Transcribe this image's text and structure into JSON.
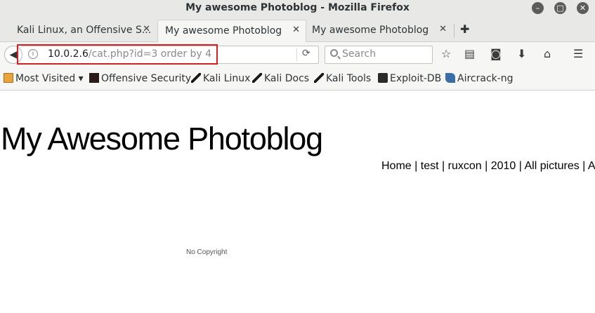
{
  "window": {
    "title": "My awesome Photoblog - Mozilla Firefox"
  },
  "tabs": [
    {
      "label": "Kali Linux, an Offensive S..."
    },
    {
      "label": "My awesome Photoblog"
    },
    {
      "label": "My awesome Photoblog"
    }
  ],
  "urlbar": {
    "host": "10.0.2.6",
    "path": "/cat.php?id=3 order by 4"
  },
  "search": {
    "placeholder": "Search"
  },
  "bookmarks": [
    {
      "label": "Most Visited ▾",
      "icon": "folder-icon"
    },
    {
      "label": "Offensive Security",
      "icon": "offsec-icon"
    },
    {
      "label": "Kali Linux",
      "icon": "kali-dragon-icon"
    },
    {
      "label": "Kali Docs",
      "icon": "kali-dragon-icon"
    },
    {
      "label": "Kali Tools",
      "icon": "kali-dragon-icon"
    },
    {
      "label": "Exploit-DB",
      "icon": "exploit-db-icon"
    },
    {
      "label": "Aircrack-ng",
      "icon": "aircrack-icon"
    }
  ],
  "page": {
    "title": "My Awesome Photoblog",
    "nav": [
      "Home",
      "test",
      "ruxcon",
      "2010",
      "All pictures",
      "A"
    ],
    "footer": "No Copyright"
  },
  "colors": {
    "highlight": "#d42020"
  }
}
